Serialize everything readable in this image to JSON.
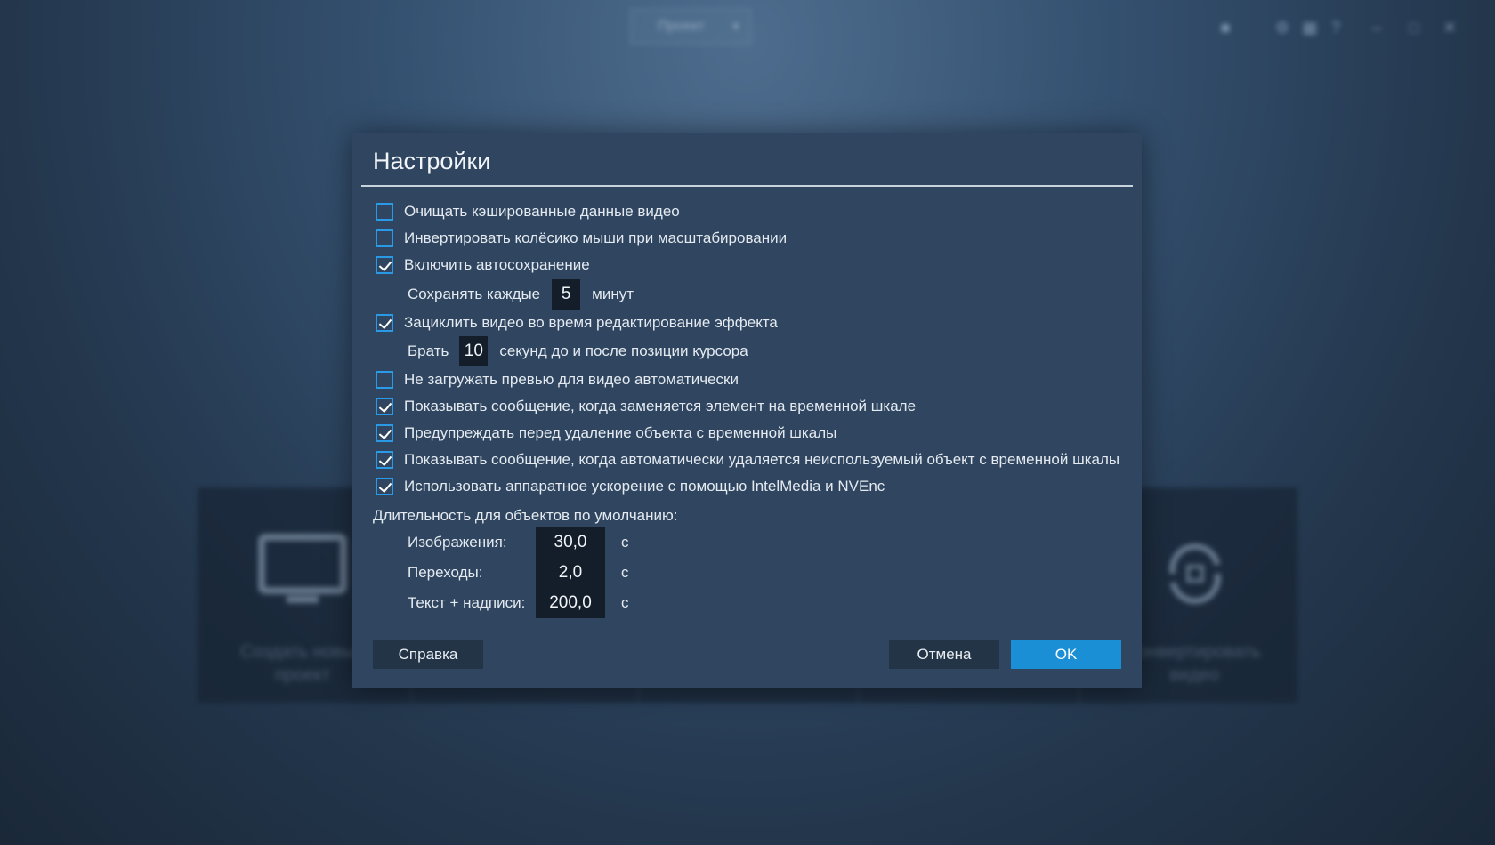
{
  "background": {
    "top_dropdown_label": "Проект",
    "window_icons": [
      "chat-icon",
      "gear-icon",
      "grid-icon",
      "help-icon",
      "minimize-icon",
      "maximize-icon",
      "close-icon"
    ],
    "cards": [
      {
        "icon": "monitor-icon",
        "text": "Создать новый проект"
      },
      {
        "icon": "convert-icon",
        "text": "Конвертировать видео"
      }
    ]
  },
  "dialog": {
    "title": "Настройки",
    "options": [
      {
        "label": "Очищать кэшированные данные видео",
        "checked": false
      },
      {
        "label": "Инвертировать колёсико мыши при масштабировании",
        "checked": false
      },
      {
        "label": "Включить автосохранение",
        "checked": true
      },
      {
        "label": "Зациклить видео во время редактирование эффекта",
        "checked": true
      },
      {
        "label": "Не загружать превью для видео автоматически",
        "checked": false
      },
      {
        "label": "Показывать сообщение, когда заменяется элемент на временной шкале",
        "checked": true
      },
      {
        "label": "Предупреждать перед удаление объекта с временной шкалы",
        "checked": true
      },
      {
        "label": "Показывать сообщение, когда автоматически удаляется неиспользуемый объект с временной шкалы",
        "checked": true
      },
      {
        "label": "Использовать аппаратное ускорение с помощью IntelMedia и NVEnc",
        "checked": true
      }
    ],
    "autosave": {
      "prefix": "Сохранять каждые",
      "value": "5",
      "suffix": "минут"
    },
    "loop": {
      "prefix": "Брать",
      "value": "10",
      "suffix": "секунд до и после позиции курсора"
    },
    "durations": {
      "title": "Длительность для объектов по умолчанию:",
      "items": [
        {
          "label": "Изображения:",
          "value": "30,0",
          "unit": "с"
        },
        {
          "label": "Переходы:",
          "value": "2,0",
          "unit": "с"
        },
        {
          "label": "Текст + надписи:",
          "value": "200,0",
          "unit": "с"
        }
      ]
    },
    "buttons": {
      "help": "Справка",
      "cancel": "Отмена",
      "ok": "OK"
    },
    "colors": {
      "dialog_bg": "#2f4560",
      "accent": "#1a8fd6",
      "checkbox_border": "#2b9ae6",
      "input_bg": "#141e2b"
    }
  }
}
